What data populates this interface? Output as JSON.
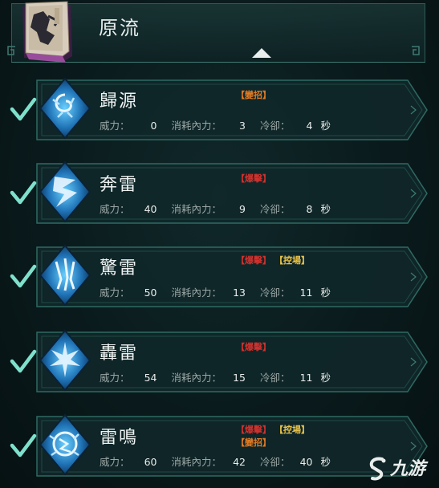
{
  "header": {
    "title": "原流",
    "book_icon": "martial-arts-manual-icon",
    "collapse_icon": "triangle-up-icon"
  },
  "labels": {
    "power": "威力：",
    "internal_cost": "消耗內力：",
    "cooldown": "冷卻：",
    "seconds": "秒"
  },
  "colors": {
    "tag_red": "#d0312d",
    "tag_orange": "#e07a24",
    "tag_yellow": "#e8c24a",
    "check": "#7fe0cc",
    "frame": "#2f6a62"
  },
  "skills": [
    {
      "name": "歸源",
      "icon": "swirl-vortex-icon",
      "tags": [
        {
          "text": "【變招】",
          "color": "orange"
        }
      ],
      "power": "0",
      "cost": "3",
      "cooldown": "4"
    },
    {
      "name": "奔雷",
      "icon": "lightning-strike-icon",
      "tags": [
        {
          "text": "【爆擊】",
          "color": "red"
        }
      ],
      "power": "40",
      "cost": "9",
      "cooldown": "8"
    },
    {
      "name": "驚雷",
      "icon": "lightning-claw-icon",
      "tags": [
        {
          "text": "【爆擊】",
          "color": "red"
        },
        {
          "text": "【控場】",
          "color": "yellow"
        }
      ],
      "power": "50",
      "cost": "13",
      "cooldown": "11"
    },
    {
      "name": "轟雷",
      "icon": "lightning-burst-icon",
      "tags": [
        {
          "text": "【爆擊】",
          "color": "red"
        }
      ],
      "power": "54",
      "cost": "15",
      "cooldown": "11"
    },
    {
      "name": "雷鳴",
      "icon": "thunder-orb-icon",
      "tags": [
        {
          "text": "【爆擊】",
          "color": "red"
        },
        {
          "text": "【控場】",
          "color": "yellow"
        },
        {
          "text": "【變招】",
          "color": "orange"
        }
      ],
      "power": "60",
      "cost": "42",
      "cooldown": "40"
    }
  ],
  "watermark": {
    "text": "九游",
    "icon": "jiuyou-logo-icon"
  }
}
